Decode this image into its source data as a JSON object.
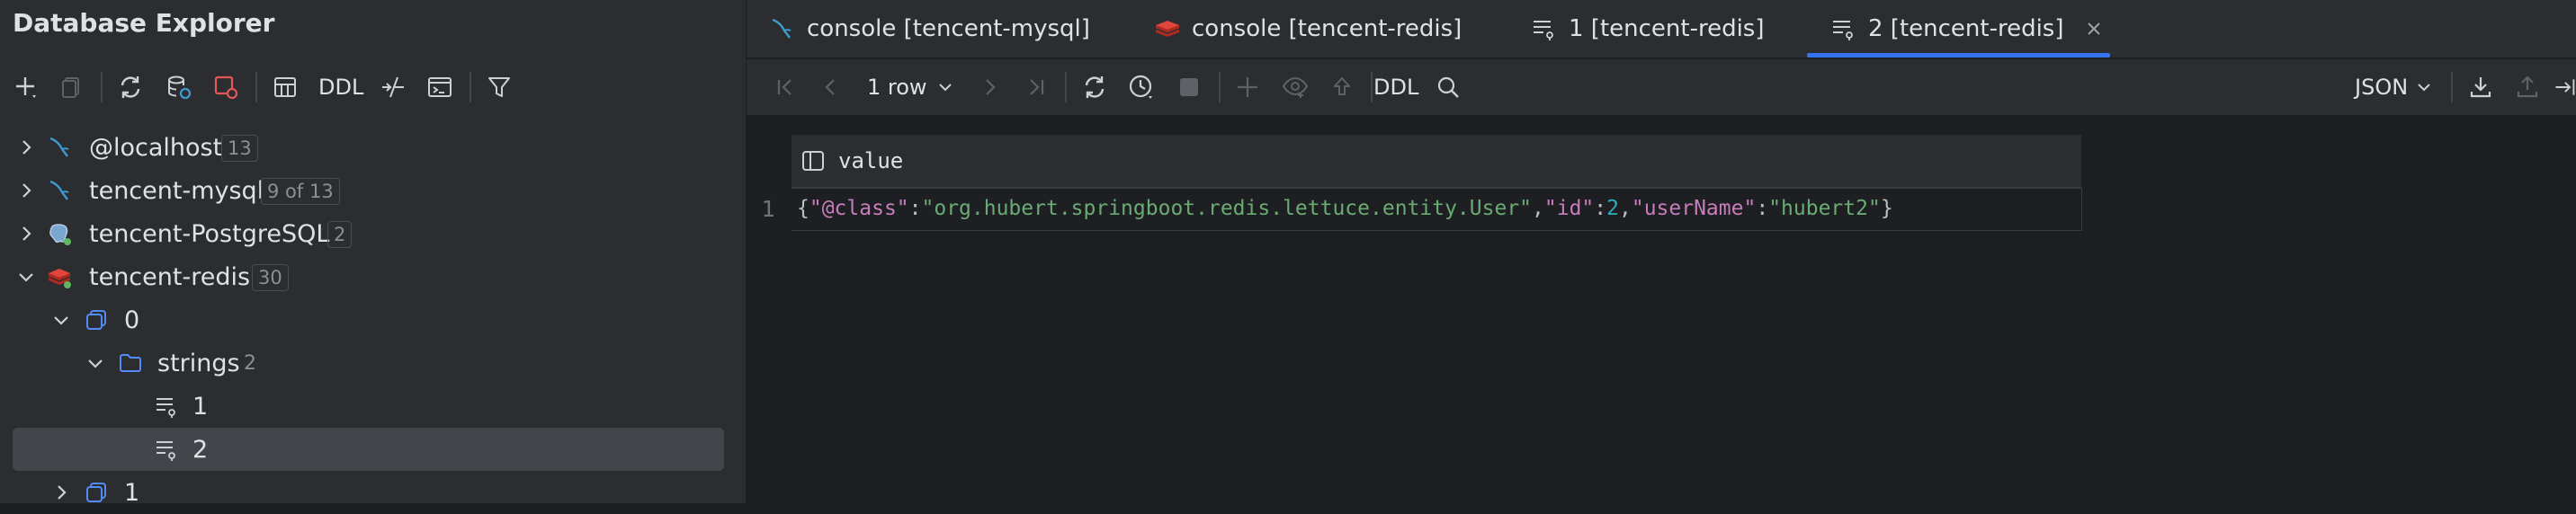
{
  "explorer": {
    "title": "Database Explorer",
    "toolbar": {
      "ddl_label": "DDL",
      "icons": [
        "add-icon",
        "copy-icon",
        "refresh-icon",
        "schema-settings-icon",
        "disconnect-icon",
        "table-icon",
        "ddl-label",
        "jump-icon",
        "console-icon",
        "filter-icon"
      ]
    },
    "tree": [
      {
        "label": "@localhost",
        "count": "13",
        "expanded": false,
        "icon": "mysql-icon"
      },
      {
        "label": "tencent-mysql",
        "count": "9 of 13",
        "expanded": false,
        "icon": "mysql-icon"
      },
      {
        "label": "tencent-PostgreSQL",
        "count": "2",
        "expanded": false,
        "icon": "postgresql-icon"
      },
      {
        "label": "tencent-redis",
        "count": "30",
        "expanded": true,
        "icon": "redis-icon"
      },
      {
        "label": "0",
        "expanded": true,
        "icon": "database-icon"
      },
      {
        "label": "strings",
        "count": "2",
        "expanded": true,
        "icon": "folder-icon"
      },
      {
        "label": "1",
        "icon": "key-icon"
      },
      {
        "label": "2",
        "icon": "key-icon",
        "selected": true
      },
      {
        "label": "1",
        "expanded": false,
        "icon": "database-icon"
      }
    ]
  },
  "tabs": [
    {
      "label": "console [tencent-mysql]",
      "icon": "mysql-console-icon"
    },
    {
      "label": "console [tencent-redis]",
      "icon": "redis-console-icon"
    },
    {
      "label": "1 [tencent-redis]",
      "icon": "key-icon"
    },
    {
      "label": "2 [tencent-redis]",
      "icon": "key-icon",
      "active": true,
      "closable": true
    }
  ],
  "grid_toolbar": {
    "rows_label": "1 row",
    "ddl_label": "DDL",
    "format_label": "JSON"
  },
  "grid": {
    "column_header": "value",
    "rows": [
      {
        "number": "1",
        "value": "{\"@class\":\"org.hubert.springboot.redis.lettuce.entity.User\",\"id\":2,\"userName\":\"hubert2\"}",
        "tokens": [
          {
            "t": "{",
            "k": "punct"
          },
          {
            "t": "\"@class\"",
            "k": "key"
          },
          {
            "t": ":",
            "k": "punct"
          },
          {
            "t": "\"org.hubert.springboot.redis.lettuce.entity.User\"",
            "k": "str"
          },
          {
            "t": ",",
            "k": "punct"
          },
          {
            "t": "\"id\"",
            "k": "key"
          },
          {
            "t": ":",
            "k": "punct"
          },
          {
            "t": "2",
            "k": "num"
          },
          {
            "t": ",",
            "k": "punct"
          },
          {
            "t": "\"userName\"",
            "k": "key"
          },
          {
            "t": ":",
            "k": "punct"
          },
          {
            "t": "\"hubert2\"",
            "k": "str"
          },
          {
            "t": "}",
            "k": "punct"
          }
        ]
      }
    ]
  },
  "colors": {
    "accent": "#3574f0",
    "json_key": "#c77dbb",
    "json_string": "#6aab73",
    "json_number": "#2aacb8",
    "mysql": "#3d9ccf",
    "redis": "#d82c20",
    "connected": "#5fb85f"
  }
}
